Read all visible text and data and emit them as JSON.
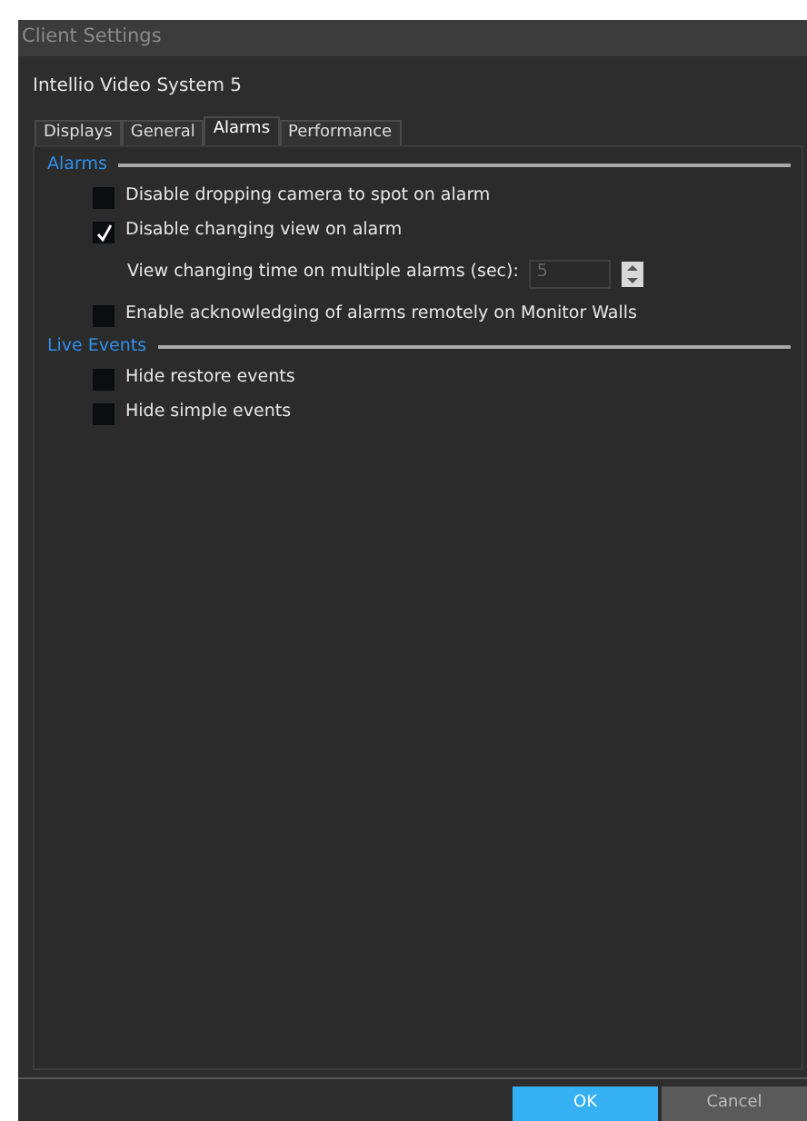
{
  "window": {
    "title": "Client Settings"
  },
  "heading": "Intellio Video System 5",
  "tabs": [
    {
      "label": "Displays",
      "selected": false
    },
    {
      "label": "General",
      "selected": false
    },
    {
      "label": "Alarms",
      "selected": true
    },
    {
      "label": "Performance",
      "selected": false
    }
  ],
  "sections": [
    {
      "title": "Alarms",
      "items": [
        {
          "kind": "checkbox",
          "label": "Disable dropping camera to spot on alarm",
          "checked": false
        },
        {
          "kind": "checkbox",
          "label": "Disable changing view on alarm",
          "checked": true
        },
        {
          "kind": "spinner",
          "label": "View changing time on multiple alarms (sec):",
          "value": "5",
          "disabled": true
        },
        {
          "kind": "checkbox",
          "label": "Enable acknowledging of alarms remotely on Monitor Walls",
          "checked": false
        }
      ]
    },
    {
      "title": "Live Events",
      "items": [
        {
          "kind": "checkbox",
          "label": "Hide restore events",
          "checked": false
        },
        {
          "kind": "checkbox",
          "label": "Hide simple events",
          "checked": false
        }
      ]
    }
  ],
  "buttons": [
    {
      "label": "OK",
      "kind": "primary"
    },
    {
      "label": "Cancel",
      "kind": "secondary"
    }
  ]
}
